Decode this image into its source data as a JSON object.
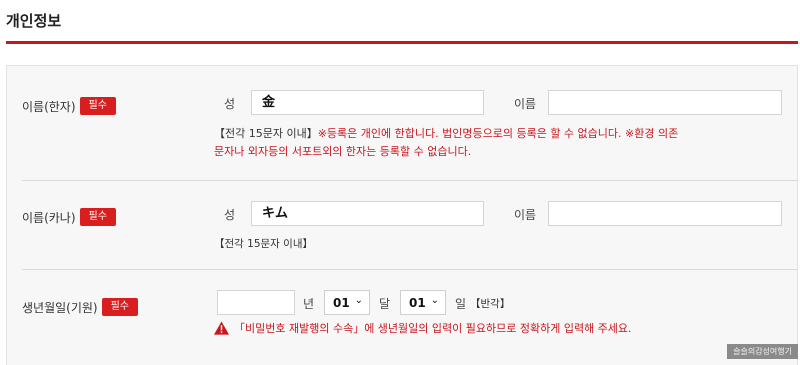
{
  "section": {
    "title": "개인정보"
  },
  "rows": {
    "hanja": {
      "label": "이름(한자)",
      "required": "필수",
      "surname_label": "성",
      "surname_value": "金",
      "given_label": "이름",
      "given_value": "",
      "hint_prefix": "【전각 15문자 이내】",
      "hint_warning_line1": "※등록은 개인에 한합니다. 법인명등으로의 등록은 할 수 없습니다. ※환경 의존",
      "hint_warning_line2": "문자나 외자등의 서포트외의 한자는 등록할 수 없습니다."
    },
    "kana": {
      "label": "이름(카나)",
      "required": "필수",
      "surname_label": "성",
      "surname_value": "キム",
      "given_label": "이름",
      "given_value": "",
      "hint": "【전각 15문자 이내】"
    },
    "birth": {
      "label": "생년월일(기원)",
      "required": "필수",
      "year_value": "",
      "year_unit": "년",
      "month_value": "01",
      "month_unit": "달",
      "day_value": "01",
      "day_unit": "일",
      "day_note": "【반각】",
      "alert": "「비밀번호 재발행의 수속」에 생년월일의 입력이 필요하므로 정확하게 입력해 주세요."
    }
  },
  "colors": {
    "accent": "#c9161e",
    "required_badge": "#d81e1e"
  },
  "icons": {
    "chevron": "chevron-down-icon",
    "warning": "warning-icon"
  },
  "watermark": "슬슬의감성여행기"
}
